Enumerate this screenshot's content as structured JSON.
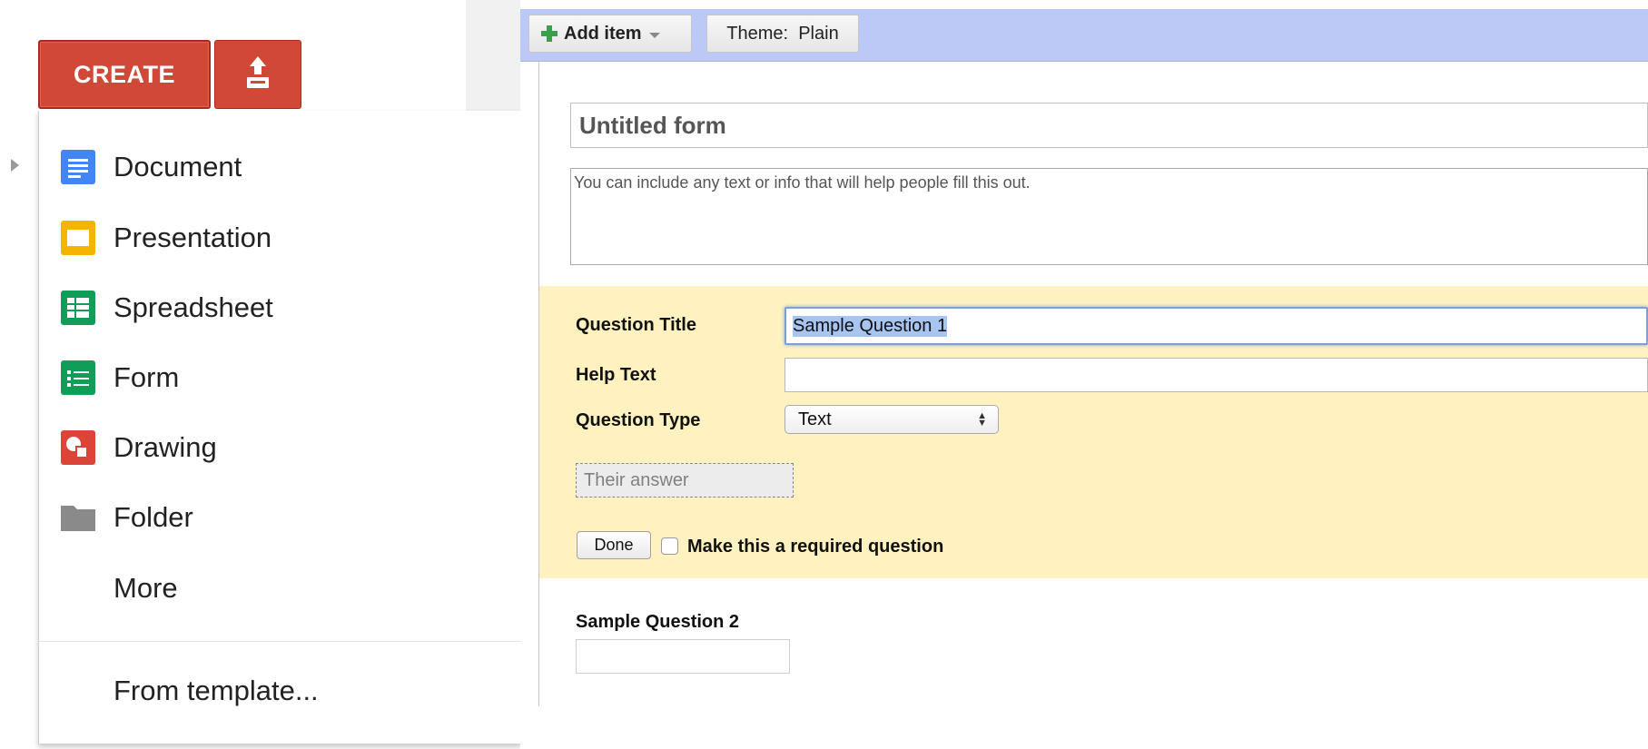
{
  "create_menu": {
    "create_label": "CREATE",
    "upload_icon": "upload-icon",
    "items": [
      {
        "label": "Document",
        "icon": "document-icon",
        "color": "#4285f4"
      },
      {
        "label": "Presentation",
        "icon": "presentation-icon",
        "color": "#f4b400"
      },
      {
        "label": "Spreadsheet",
        "icon": "spreadsheet-icon",
        "color": "#0f9d58"
      },
      {
        "label": "Form",
        "icon": "form-icon",
        "color": "#0f9d58"
      },
      {
        "label": "Drawing",
        "icon": "drawing-icon",
        "color": "#db4437"
      },
      {
        "label": "Folder",
        "icon": "folder-icon",
        "color": "#8a8a8a"
      },
      {
        "label": "More",
        "icon": "",
        "color": ""
      }
    ],
    "from_template": "From template...",
    "accent": "#d14836"
  },
  "form_editor": {
    "toolbar": {
      "add_item_label": "Add item",
      "theme_label": "Theme:  Plain",
      "toolbar_color": "#bcc8f5"
    },
    "form_title": "Untitled form",
    "form_description": "You can include any text or info that will help people fill this out.",
    "question": {
      "title_label": "Question Title",
      "title_value": "Sample Question 1",
      "help_label": "Help Text",
      "help_value": "",
      "type_label": "Question Type",
      "type_value": "Text",
      "answer_placeholder": "Their answer",
      "done_label": "Done",
      "required_label": "Make this a required question",
      "required_checked": false,
      "background": "#fff2c0"
    },
    "question_2": {
      "title": "Sample Question 2"
    }
  }
}
